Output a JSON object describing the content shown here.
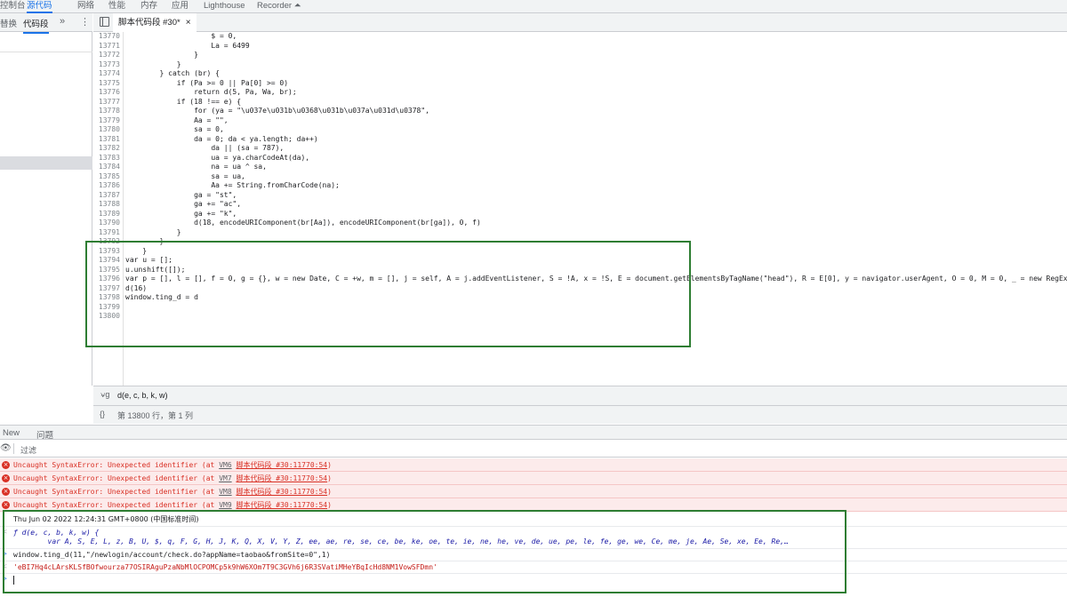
{
  "topbar": {
    "tabs": [
      {
        "label": "控制台",
        "active": false
      },
      {
        "label": "源代码",
        "active": true
      },
      {
        "label": "网络",
        "active": false
      },
      {
        "label": "性能",
        "active": false
      },
      {
        "label": "内存",
        "active": false
      },
      {
        "label": "应用",
        "active": false
      },
      {
        "label": "Lighthouse",
        "active": false
      },
      {
        "label": "Recorder ⏶",
        "active": false
      }
    ]
  },
  "navigator": {
    "tabs": [
      {
        "label": "替换",
        "active": false
      },
      {
        "label": "代码段",
        "active": true
      }
    ],
    "more": "»",
    "menu": "⋮"
  },
  "editor": {
    "file_tab": "脚本代码段 #30*",
    "close": "×",
    "line_numbers": [
      "13770",
      "13771",
      "13772",
      "13773",
      "13774",
      "13775",
      "13776",
      "13777",
      "13778",
      "13779",
      "13780",
      "13781",
      "13782",
      "13783",
      "13784",
      "13785",
      "13786",
      "13787",
      "13788",
      "13789",
      "13790",
      "13791",
      "13792",
      "13793",
      "13794",
      "13795",
      "13796",
      "13797",
      "13798",
      "13799",
      "13800"
    ],
    "lines": [
      "                    $ = 0,",
      "                    La = 6499",
      "                }",
      "            }",
      "        } catch (br) {",
      "            if (Pa >= 0 || Pa[0] >= 0)",
      "                return d(5, Pa, Wa, br);",
      "            if (18 !== e) {",
      "                for (ya = \"\\u037e\\u031b\\u0368\\u031b\\u037a\\u031d\\u0378\",",
      "                Aa = \"\",",
      "                sa = 0,",
      "                da = 0; da < ya.length; da++)",
      "                    da || (sa = 787),",
      "                    ua = ya.charCodeAt(da),",
      "                    na = ua ^ sa,",
      "                    sa = ua,",
      "                    Aa += String.fromCharCode(na);",
      "                ga = \"st\",",
      "                ga += \"ac\",",
      "                ga += \"k\",",
      "                d(18, encodeURIComponent(br[Aa]), encodeURIComponent(br[ga]), 0, f)",
      "            }",
      "        }",
      "    }",
      "var u = [];",
      "u.unshift([]);",
      "var p = [], l = [], f = 0, g = {}, w = new Date, C = +w, m = [], j = self, A = j.addEventListener, S = !A, x = !S, E = document.getElementsByTagName(\"head\"), R = E[0], y = navigator.userAgent, O = 0, M = 0, _ = new RegExp(\"\\",
      "d(16)",
      "window.ting_d = d",
      "",
      ""
    ]
  },
  "searchbar": {
    "icon": "⍱g",
    "text": "d(e, c, b, k, w)"
  },
  "statusbar": {
    "icon": "{}",
    "text": "第 13800 行，第 1 列"
  },
  "drawer": {
    "tabs": [
      "New",
      "问题"
    ],
    "filter_placeholder": "过滤"
  },
  "console": {
    "errors": [
      {
        "prefix": "Uncaught SyntaxError: Unexpected identifier (at ",
        "link": "VM6",
        "link2": "脚本代码段 #30:11770:54",
        "suffix": ")"
      },
      {
        "prefix": "Uncaught SyntaxError: Unexpected identifier (at ",
        "link": "VM7",
        "link2": "脚本代码段 #30:11770:54",
        "suffix": ")"
      },
      {
        "prefix": "Uncaught SyntaxError: Unexpected identifier (at ",
        "link": "VM8",
        "link2": "脚本代码段 #30:11770:54",
        "suffix": ")"
      },
      {
        "prefix": "Uncaught SyntaxError: Unexpected identifier (at ",
        "link": "VM9",
        "link2": "脚本代码段 #30:11770:54",
        "suffix": ")"
      }
    ],
    "date_line": "Thu Jun 02 2022 12:24:31 GMT+0800 (中国标准时间)",
    "func_sig": "ƒ d(e, c, b, k, w) {",
    "func_body": "        var A, S, E, L, z, B, U, $, q, F, G, H, J, K, Q, X, V, Y, Z, ee, ae, re, se, ce, be, ke, oe, te, ie, ne, he, ve, de, ue, pe, le, fe, ge, we, Ce, me, je, Ae, Se, xe, Ee, Re,…",
    "input_cmd": "window.ting_d(11,\"/newlogin/account/check.do?appName=taobao&fromSite=0\",1)",
    "result": "'eBI7Hq4cLArsKLSfBOfwourza77OSIRAguPzaNbMlOCPOMCp5k9hW6XOm7T9C3GVh6j6R3SVatiMHeYBqIcHd8NM1VowSFDmn'",
    "prompt_arrow": ">",
    "result_arrow": "<"
  },
  "colors": {
    "highlight_box": "#2e7d32",
    "error_bg": "#fcebeb",
    "error_text": "#d93025",
    "accent": "#1a73e8"
  }
}
